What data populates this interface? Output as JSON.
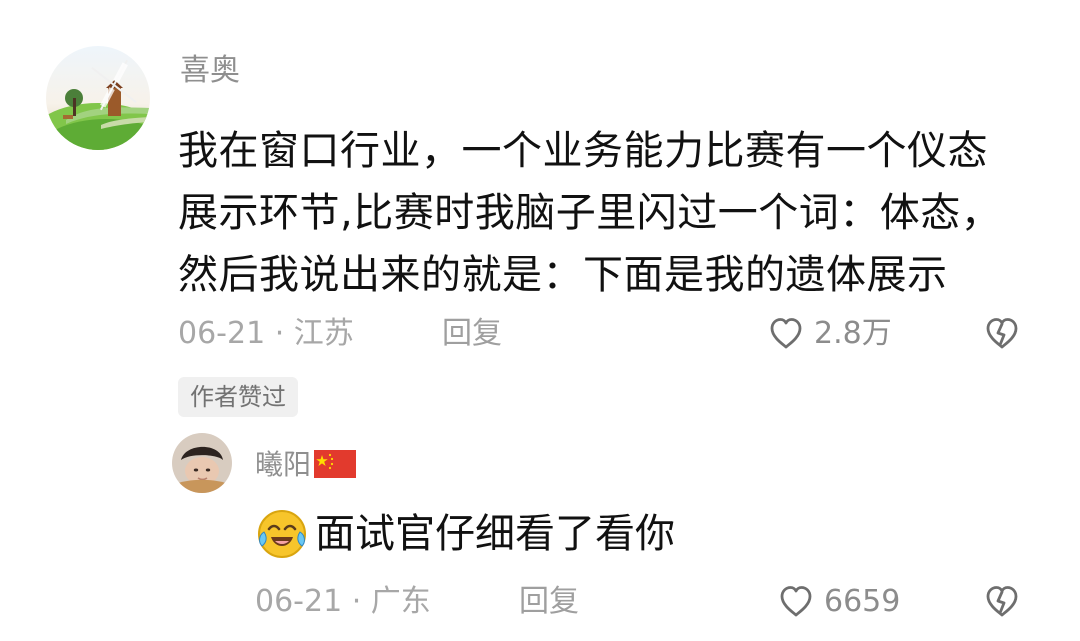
{
  "comment": {
    "username": "喜奥",
    "text_lines": [
      "我在窗口行业，一个业务能力比赛有一个仪态",
      "展示环节,比赛时我脑子里闪过一个词：体态，",
      "然后我说出来的就是：下面是我的遗体展示"
    ],
    "date_location": "06-21 · 江苏",
    "reply_label": "回复",
    "likes": "2.8万",
    "author_badge": "作者赞过"
  },
  "reply": {
    "username": "曦阳",
    "flag": "china-flag-icon",
    "text": "面试官仔细看了看你",
    "emoji": "crying-laughing-emoji-icon",
    "date_location": "06-21 · 广东",
    "reply_label": "回复",
    "likes": "6659"
  },
  "icons": {
    "like": "heart-outline-icon",
    "dislike": "broken-heart-icon"
  },
  "colors": {
    "text": "#111111",
    "secondary": "#a7a7a7",
    "badge_bg": "#f0f0f0"
  }
}
